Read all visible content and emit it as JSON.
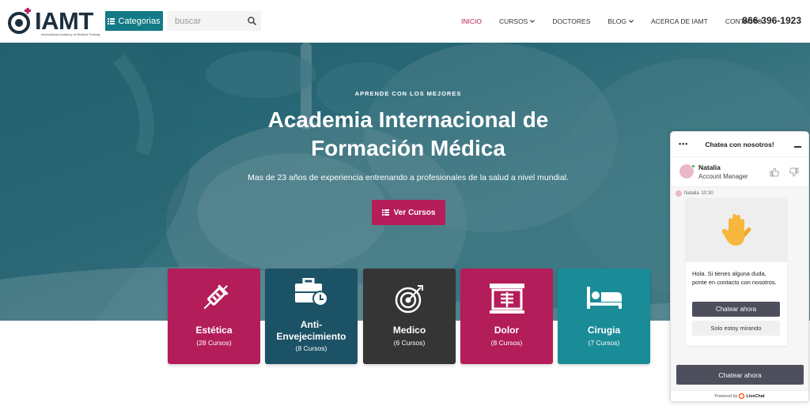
{
  "header": {
    "logo_text": "IAMT",
    "logo_subtitle": "International Academy of Medical Training",
    "categories_label": "Categorias",
    "search_placeholder": "buscar",
    "nav": [
      {
        "label": "INICIO",
        "active": true,
        "has_dropdown": false
      },
      {
        "label": "CURSOS",
        "active": false,
        "has_dropdown": true
      },
      {
        "label": "DOCTORES",
        "active": false,
        "has_dropdown": false
      },
      {
        "label": "BLOG",
        "active": false,
        "has_dropdown": true
      },
      {
        "label": "ACERCA DE IAMT",
        "active": false,
        "has_dropdown": false
      },
      {
        "label": "CONTACTO",
        "active": false,
        "has_dropdown": false
      }
    ],
    "phone": "866-396-1923"
  },
  "hero": {
    "eyebrow": "APRENDE CON LOS MEJORES",
    "title_line1": "Academia Internacional de",
    "title_line2": "Formación Médica",
    "subtitle": "Mas de 23 años de experiencia entrenando a profesionales de la salud a nivel mundial.",
    "cta_label": "Ver Cursos"
  },
  "categories": [
    {
      "name": "Estética",
      "count": "(28 Cursos)",
      "icon": "syringe-icon",
      "color": "#b31d59"
    },
    {
      "name": "Anti-\nEnvejecimiento",
      "count": "(8 Cursos)",
      "icon": "briefcase-clock-icon",
      "color": "#1c5266"
    },
    {
      "name": "Medico",
      "count": "(6 Cursos)",
      "icon": "target-icon",
      "color": "#353535"
    },
    {
      "name": "Dolor",
      "count": "(8 Cursos)",
      "icon": "xray-icon",
      "color": "#b31d59"
    },
    {
      "name": "Cirugia",
      "count": "(7 Cursos)",
      "icon": "bed-icon",
      "color": "#1a8c97"
    }
  ],
  "chat": {
    "title": "Chatea con nosotros!",
    "agent_name": "Natalia",
    "agent_role": "Account Manager",
    "message_author": "Natalia",
    "message_time": "10:30",
    "message_text": "Hola. Si tienes alguna duda, ponte en contacto con nosotros.",
    "primary_button": "Chatear ahora",
    "secondary_button": "Solo estoy mirando",
    "cta_button": "Chatear ahora",
    "powered_prefix": "Powered by",
    "powered_brand": "LiveChat"
  },
  "colors": {
    "accent": "#b51e5a",
    "teal": "#137b85",
    "dark_navy": "#1c2f3e"
  }
}
